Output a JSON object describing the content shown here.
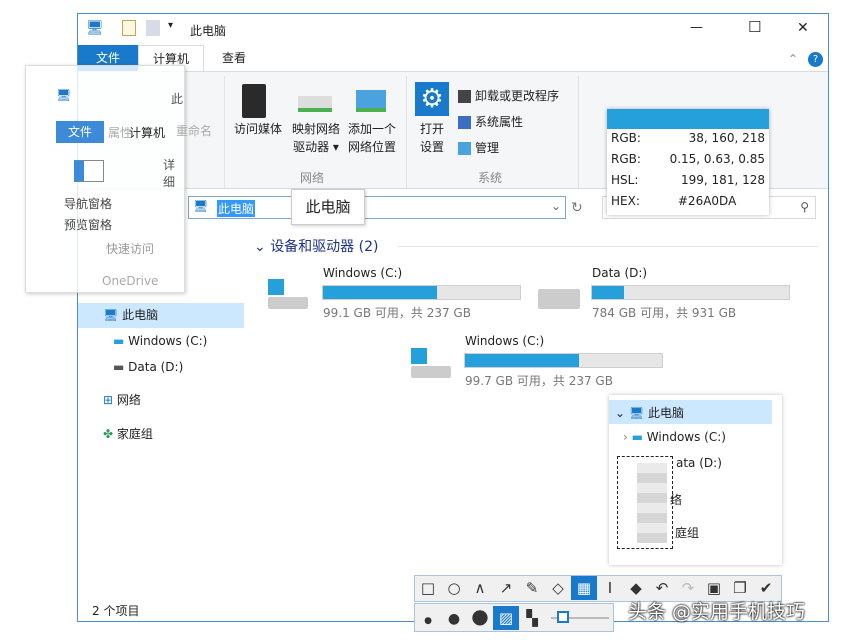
{
  "window": {
    "title": "此电脑",
    "minimize": "—",
    "maximize": "☐",
    "close": "✕"
  },
  "tabs": [
    "文件",
    "计算机",
    "查看"
  ],
  "ribbon": {
    "network": {
      "items": [
        "访问媒体",
        "映射网络驱动器 ▾",
        "添加一个网络位置"
      ],
      "media": "访问媒体",
      "map1": "映射网络",
      "map2": "驱动器 ▾",
      "add1": "添加一个",
      "add2": "网络位置",
      "group": "网络"
    },
    "system": {
      "open1": "打开",
      "open2": "设置",
      "uninstall": "卸载或更改程序",
      "props": "系统属性",
      "manage": "管理",
      "group": "系统"
    }
  },
  "address": {
    "value": "此电脑",
    "tooltip": "此电脑"
  },
  "color_picker": {
    "swatch": "#26A0DA",
    "rows": [
      [
        "RGB:",
        "38,  160,  218"
      ],
      [
        "RGB:",
        "0.15, 0.63, 0.85"
      ],
      [
        "HSL:",
        "199,  181,  128"
      ],
      [
        "HEX:",
        "#26A0DA"
      ]
    ]
  },
  "nav": {
    "items": [
      "此电脑",
      "Windows (C:)",
      "Data (D:)",
      "网络",
      "家庭组"
    ]
  },
  "section": "设备和驱动器 (2)",
  "drives": [
    {
      "name": "Windows (C:)",
      "info": "99.1 GB 可用，共 237 GB",
      "used": 0.58
    },
    {
      "name": "Data (D:)",
      "info": "784 GB 可用，共 931 GB",
      "used": 0.16
    },
    {
      "name": "Windows (C:)",
      "info": "99.7 GB 可用，共 237 GB",
      "used": 0.58
    }
  ],
  "status": "2 个项目",
  "ghost": {
    "tab1": "文件",
    "tab2": "计算机",
    "nav": "导航窗格",
    "preview": "预览窗格",
    "quick": "快速访问",
    "onedrive": "OneDrive",
    "title": "此",
    "details": "详细",
    "rename": "重命名",
    "attr": "属性"
  },
  "magnifier": {
    "items": [
      "此电脑",
      "Windows (C:)",
      "ata (D:)",
      "络",
      "庭组"
    ]
  },
  "watermark": "头条 @实用手机技巧",
  "colors": {
    "accent": "#26a0da",
    "tabFile": "#1979ca"
  }
}
